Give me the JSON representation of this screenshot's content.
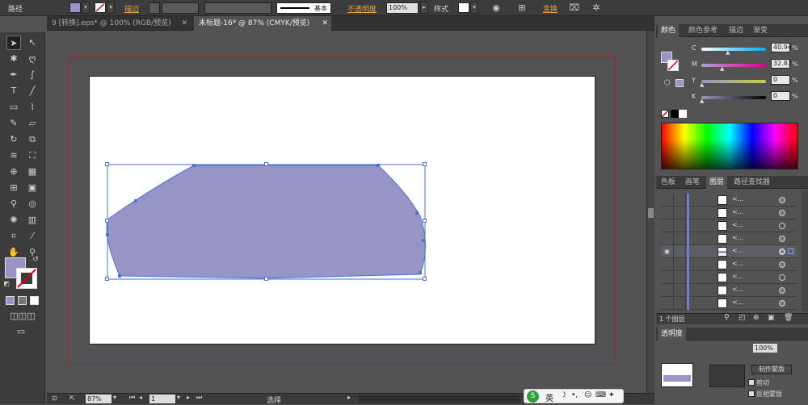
{
  "control_bar": {
    "object_type": "路径",
    "stroke_label": "描边",
    "brush_label": "基本",
    "opacity_label": "不透明度",
    "opacity_value": "100%",
    "style_label": "样式",
    "transform_label": "变换"
  },
  "doc_tabs": [
    {
      "label": "9 [转换].eps* @ 100% (RGB/预览)"
    },
    {
      "label": "未标题-16* @ 87% (CMYK/预览)"
    }
  ],
  "status": {
    "zoom": "87%",
    "page": "1",
    "tool": "选择"
  },
  "color_panel": {
    "tabs": [
      "颜色",
      "颜色参考",
      "描边",
      "渐变"
    ],
    "sliders": [
      {
        "label": "C",
        "value": "40.94",
        "unit": "%"
      },
      {
        "label": "M",
        "value": "32.83",
        "unit": "%"
      },
      {
        "label": "Y",
        "value": "0",
        "unit": "%"
      },
      {
        "label": "K",
        "value": "0",
        "unit": "%"
      }
    ]
  },
  "layers_panel": {
    "tabs": [
      "色板",
      "画笔",
      "图层",
      "路径查找器"
    ],
    "footer": "1 个图层",
    "rows": [
      {
        "name": "<..."
      },
      {
        "name": "<..."
      },
      {
        "name": "<..."
      },
      {
        "name": "<..."
      },
      {
        "name": "<..."
      },
      {
        "name": "<..."
      },
      {
        "name": "<..."
      },
      {
        "name": "<..."
      },
      {
        "name": "<..."
      }
    ]
  },
  "transparency_panel": {
    "title": "透明度",
    "opacity_value": "100%",
    "make_mask": "制作蒙版",
    "clip": "剪切",
    "invert_mask": "反相蒙版"
  },
  "ime": {
    "label": "英"
  },
  "colors": {
    "shape_fill": "#9795c6",
    "shape_outline": "#4a73d6",
    "bleed": "#b02020"
  }
}
